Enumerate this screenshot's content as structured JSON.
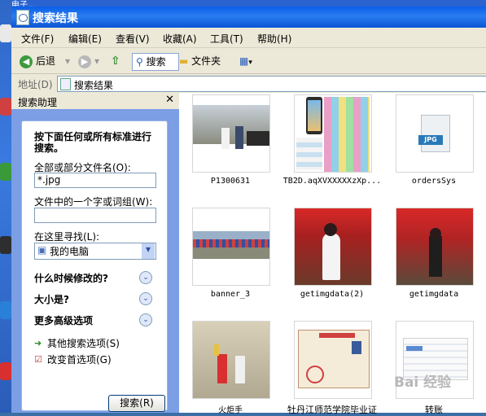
{
  "desktop": {
    "top_fragment": "电子..."
  },
  "window": {
    "title": "搜索结果"
  },
  "menu": [
    "文件(F)",
    "编辑(E)",
    "查看(V)",
    "收藏(A)",
    "工具(T)",
    "帮助(H)"
  ],
  "toolbar": {
    "back": "后退",
    "search": "搜索",
    "folders": "文件夹"
  },
  "address": {
    "label": "地址(D)",
    "value": "搜索结果"
  },
  "pane": {
    "title": "搜索助理",
    "heading": "按下面任何或所有标准进行搜索。",
    "filename_label": "全部或部分文件名(O):",
    "filename_value": "*.jpg",
    "phrase_label": "文件中的一个字或词组(W):",
    "phrase_value": "",
    "lookin_label": "在这里寻找(L):",
    "lookin_value": "我的电脑",
    "sections": [
      "什么时候修改的?",
      "大小是?",
      "更多高级选项"
    ],
    "options": [
      "其他搜索选项(S)",
      "改变首选项(G)"
    ],
    "search_button": "搜索(R)"
  },
  "results": [
    {
      "name": "P1300631",
      "kind": "photo-people"
    },
    {
      "name": "TB2D.aqXVXXXXXzXp...",
      "kind": "collage"
    },
    {
      "name": "ordersSys",
      "kind": "jpg-file"
    },
    {
      "name": "banner_3",
      "kind": "banner"
    },
    {
      "name": "getimgdata(2)",
      "kind": "stage"
    },
    {
      "name": "getimgdata",
      "kind": "stage2"
    },
    {
      "name": "火炬手",
      "kind": "torch"
    },
    {
      "name": "牡丹江师范学院毕业证",
      "kind": "certificate"
    },
    {
      "name": "转账",
      "kind": "doc"
    }
  ],
  "file_badge": "JPG",
  "watermark": "Bai 经验",
  "colors": {
    "titlebar": "#0a5ee8",
    "pane": "#7b9ee4",
    "desktop": "#3a6ea5"
  }
}
